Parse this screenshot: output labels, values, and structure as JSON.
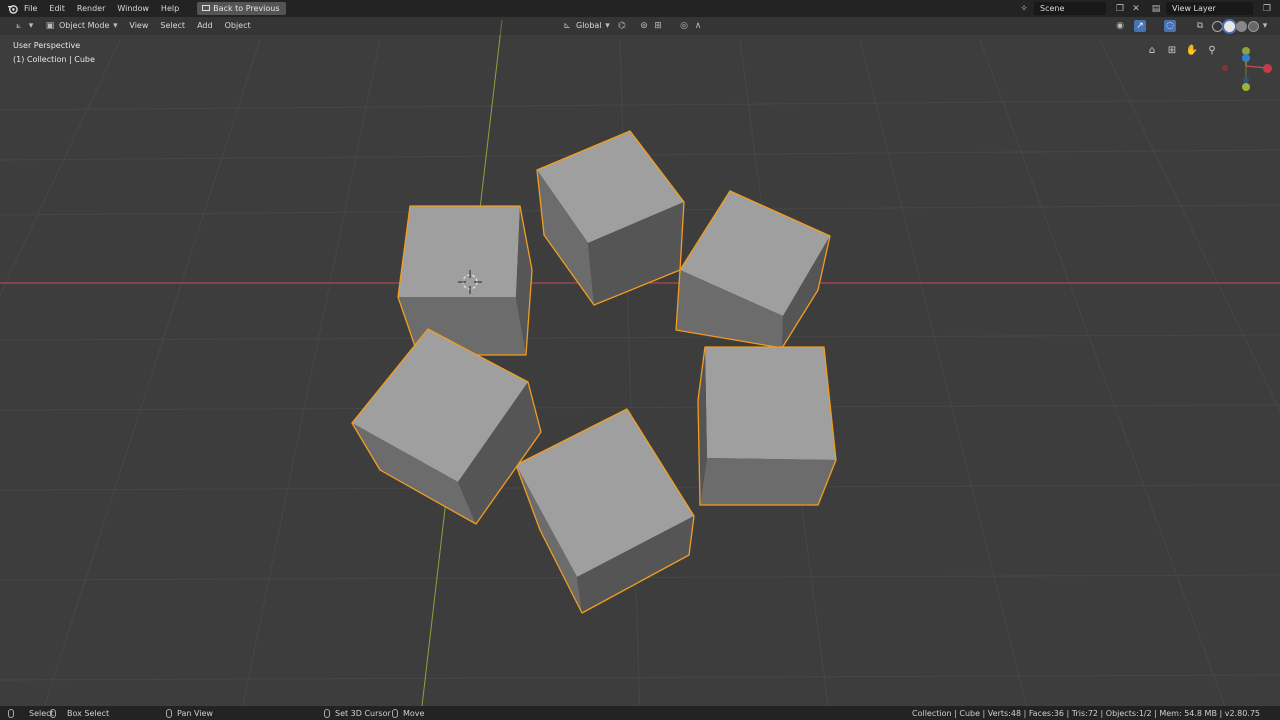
{
  "menus": [
    "File",
    "Edit",
    "Render",
    "Window",
    "Help"
  ],
  "back_button": "Back to Previous",
  "scene": "Scene",
  "view_layer": "View Layer",
  "header": {
    "mode": "Object Mode",
    "menus": [
      "View",
      "Select",
      "Add",
      "Object"
    ],
    "orientation": "Global"
  },
  "viewport": {
    "perspective_label": "User Perspective",
    "collection_label": "(1) Collection | Cube"
  },
  "statusbar": {
    "select": "Select",
    "box_select": "Box Select",
    "pan_view": "Pan View",
    "set_cursor": "Set 3D Cursor",
    "move": "Move",
    "stats": "Collection | Cube | Verts:48 | Faces:36 | Tris:72 | Objects:1/2 | Mem: 54.8 MB | v2.80.75"
  },
  "colors": {
    "background": "#3d3d3d",
    "selection_outline": "#f29d1f",
    "x_axis": "#c84a55",
    "y_axis": "#8ea23a"
  }
}
